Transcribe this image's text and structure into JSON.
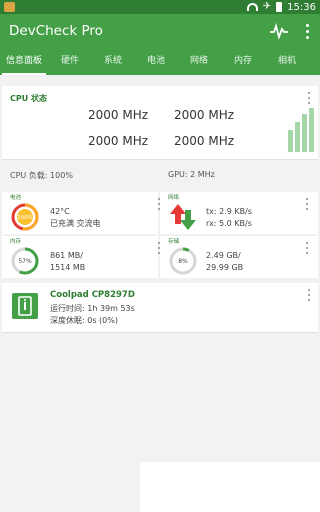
{
  "status_bar": {
    "time": "15:36",
    "icons": [
      "app-icon",
      "wifi-icon",
      "airplane-icon",
      "battery-icon"
    ]
  },
  "app_bar": {
    "title": "DevCheck Pro",
    "icons": [
      "pulse-icon",
      "overflow-menu-icon"
    ]
  },
  "tabs": [
    {
      "label": "信息面板",
      "active": true
    },
    {
      "label": "硬件"
    },
    {
      "label": "系统"
    },
    {
      "label": "电池"
    },
    {
      "label": "网络"
    },
    {
      "label": "内存"
    },
    {
      "label": "相机"
    }
  ],
  "cpu": {
    "title": "CPU 状态",
    "freqs": [
      "2000 MHz",
      "2000 MHz",
      "2000 MHz",
      "2000 MHz"
    ],
    "load": "CPU 负载: 100%",
    "gpu": "GPU: 2 MHz"
  },
  "battery": {
    "label": "电池",
    "percent_text": "100%",
    "temp": "42°C",
    "state": "已充满 交流电",
    "level": 1.0
  },
  "network": {
    "label": "网络",
    "tx": "tx: 2.9 KB/s",
    "rx": "rx: 5.0 KB/s"
  },
  "memory": {
    "label": "内存",
    "percent_text": "57%",
    "used": "861 MB/",
    "total": "1514 MB",
    "level": 0.57
  },
  "storage": {
    "label": "存储",
    "percent_text": "8%",
    "used": "2.49 GB/",
    "total": "29.99 GB",
    "level": 0.08
  },
  "device": {
    "name": "Coolpad CP8297D",
    "uptime": "运行时间: 1h 39m 53s",
    "deep_sleep": "深度休眠: 0s (0%)"
  },
  "colors": {
    "primary": "#43a047",
    "primary_dark": "#2e7d32",
    "accent_red": "#e53935"
  }
}
